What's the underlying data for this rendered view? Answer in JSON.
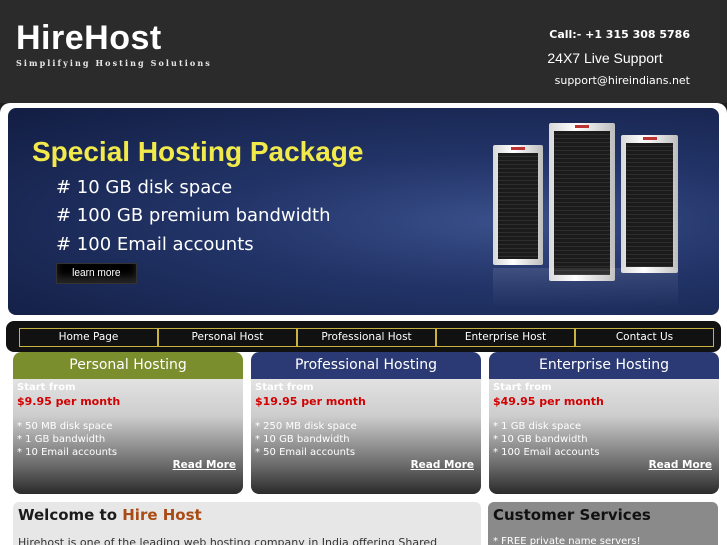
{
  "header": {
    "logo": "HireHost",
    "tagline": "Simplifying Hosting Solutions",
    "call": "Call:-  +1 315  308  5786",
    "live_support": "24X7 Live Support",
    "email": "support@hireindians.net"
  },
  "banner": {
    "title": "Special Hosting Package",
    "lines": [
      "# 10 GB disk space",
      "# 100 GB premium bandwidth",
      "# 100 Email accounts"
    ],
    "button": "learn more"
  },
  "nav": {
    "items": [
      "Home Page",
      "Personal Host",
      "Professional Host",
      "Enterprise Host",
      "Contact Us"
    ]
  },
  "plans": [
    {
      "title": "Personal Hosting",
      "start": "Start from",
      "price": "$9.95 per month",
      "features": [
        "* 50 MB disk space",
        "* 1 GB bandwidth",
        "* 10 Email accounts"
      ],
      "more": "Read More",
      "color": "#7a8e2d"
    },
    {
      "title": "Professional Hosting",
      "start": "Start from",
      "price": "$19.95 per month",
      "features": [
        "* 250 MB disk space",
        "* 10 GB bandwidth",
        "* 50 Email accounts"
      ],
      "more": "Read More",
      "color": "#2b3a74"
    },
    {
      "title": "Enterprise Hosting",
      "start": "Start from",
      "price": "$49.95 per month",
      "features": [
        "* 1 GB disk space",
        "* 10 GB bandwidth",
        "* 100 Email accounts"
      ],
      "more": "Read More",
      "color": "#2b3a74"
    }
  ],
  "welcome": {
    "title_prefix": "Welcome to ",
    "title_accent": "Hire Host",
    "text": "Hirehost is one of the leading web hosting company in India offering Shared"
  },
  "services": {
    "title": "Customer Services",
    "text": "* FREE private name servers!"
  }
}
